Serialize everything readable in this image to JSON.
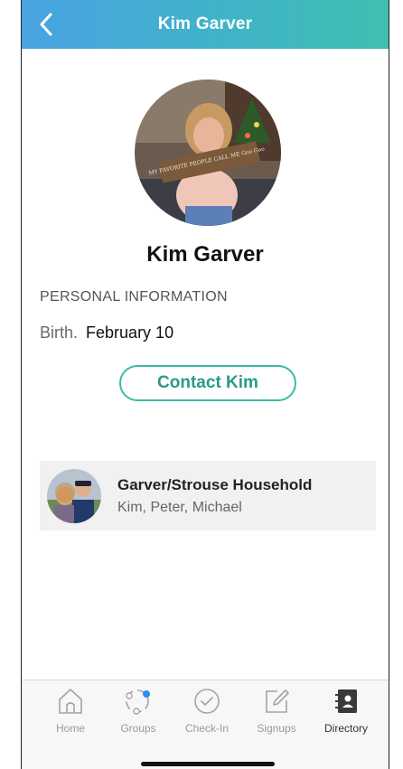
{
  "header": {
    "title": "Kim Garver",
    "back_icon": "chevron-left-icon"
  },
  "profile": {
    "photo_sign_text": "MY FAVORITE PEOPLE CALL ME Goo Goo",
    "name": "Kim Garver",
    "section_title": "PERSONAL INFORMATION",
    "birth_label": "Birth.",
    "birth_value": "February 10",
    "contact_label": "Contact Kim"
  },
  "household": {
    "title": "Garver/Strouse Household",
    "members": "Kim, Peter, Michael"
  },
  "tabs": [
    {
      "label": "Home",
      "icon": "home-icon",
      "active": false
    },
    {
      "label": "Groups",
      "icon": "groups-icon",
      "active": false
    },
    {
      "label": "Check-In",
      "icon": "check-circle-icon",
      "active": false
    },
    {
      "label": "Signups",
      "icon": "edit-icon",
      "active": false
    },
    {
      "label": "Directory",
      "icon": "directory-icon",
      "active": true
    }
  ],
  "colors": {
    "header_start": "#4aa3e3",
    "header_end": "#40bfb0",
    "accent": "#2a9b86",
    "groups_dot": "#2f8cf0"
  }
}
